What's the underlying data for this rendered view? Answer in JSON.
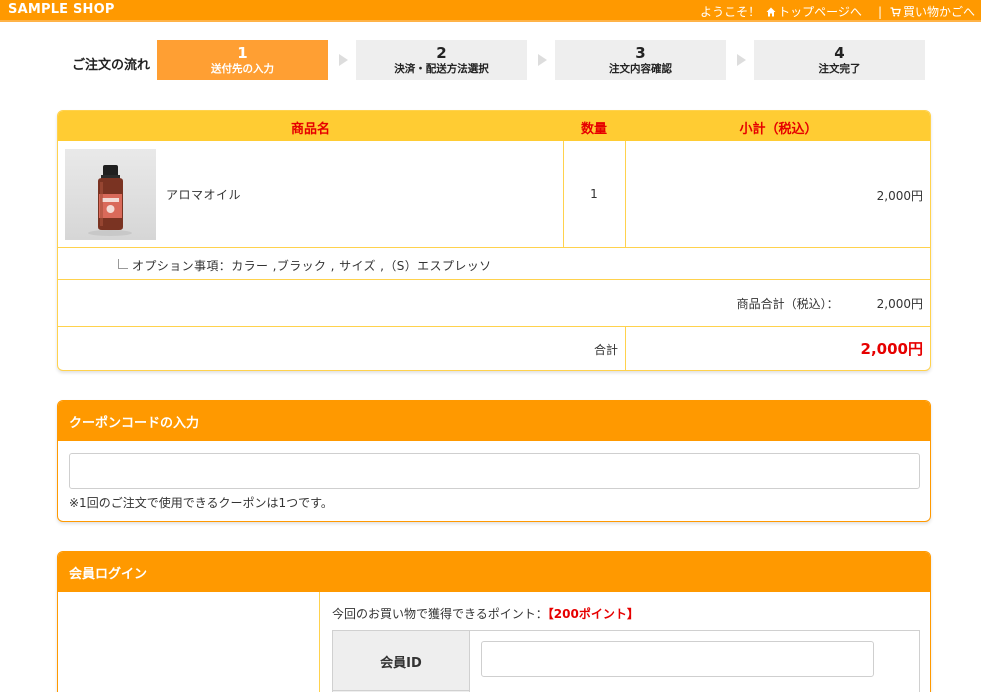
{
  "header": {
    "brand": "SAMPLE SHOP",
    "welcome": "ようこそ！",
    "top_page": "トップページへ",
    "separator": "|",
    "cart": "買い物かごへ"
  },
  "steps": {
    "label": "ご注文の流れ",
    "items": [
      {
        "num": "1",
        "label": "送付先の入力",
        "active": true
      },
      {
        "num": "2",
        "label": "決済・配送方法選択",
        "active": false
      },
      {
        "num": "3",
        "label": "注文内容確認",
        "active": false
      },
      {
        "num": "4",
        "label": "注文完了",
        "active": false
      }
    ]
  },
  "cart": {
    "headers": {
      "name": "商品名",
      "qty": "数量",
      "subtotal": "小計（税込）"
    },
    "item": {
      "name": "アロマオイル",
      "qty": "1",
      "subtotal": "2,000円",
      "option": "オプション事項：カラー ,ブラック , サイズ ,（S）エスプレッソ"
    },
    "goods_total_label": "商品合計（税込）：",
    "goods_total_value": "2,000円",
    "grand_label": "合計",
    "grand_value": "2,000円"
  },
  "coupon": {
    "title": "クーポンコードの入力",
    "value": "",
    "note": "※1回のご注文で使用できるクーポンは1つです。"
  },
  "login": {
    "title": "会員ログイン",
    "points_prefix": "今回のお買い物で獲得できるポイント：",
    "points_value": "【200ポイント】",
    "id_label": "会員ID",
    "id_value": ""
  },
  "colors": {
    "header_orange": "#ff9900",
    "step_active": "#ff9f33",
    "table_header_yellow": "#ffcc33",
    "price_red": "#e60000"
  },
  "icons": {
    "home": "home-icon",
    "cart": "cart-icon",
    "option_tree": "tree-branch-icon"
  }
}
